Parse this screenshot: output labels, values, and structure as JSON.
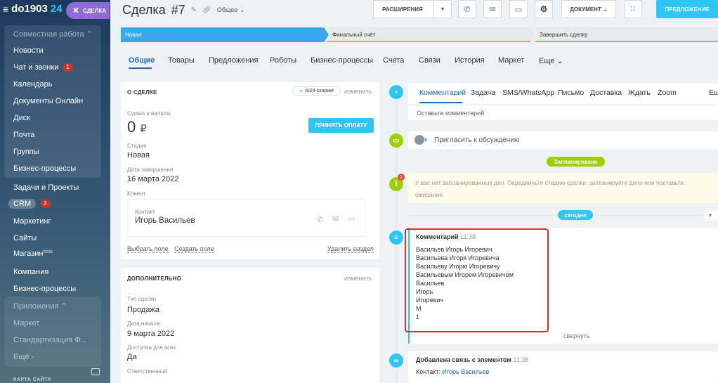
{
  "sidebar": {
    "portal_name": "do1903",
    "portal_suffix": "24",
    "close_label": "СДЕЛКА",
    "group_title": "Совместная работа",
    "items": [
      {
        "label": "Новости"
      },
      {
        "label": "Чат и звонки",
        "badge": "1"
      },
      {
        "label": "Календарь"
      },
      {
        "label": "Документы Онлайн"
      },
      {
        "label": "Диск"
      },
      {
        "label": "Почта"
      },
      {
        "label": "Группы"
      },
      {
        "label": "Бизнес-процессы"
      },
      {
        "label": "Задачи и Проекты"
      },
      {
        "label": "CRM",
        "badge": "2"
      },
      {
        "label": "Маркетинг"
      },
      {
        "label": "Сайты"
      },
      {
        "label": "Магазин",
        "sup": "beta"
      },
      {
        "label": "Компания"
      },
      {
        "label": "Бизнес-процессы"
      }
    ],
    "group2_title": "Приложения",
    "group2_items": [
      {
        "label": "Маркет"
      },
      {
        "label": "Стандартизация Ф..."
      },
      {
        "label": "Ещё -"
      }
    ],
    "footer_label": "КАРТА САЙТА"
  },
  "header": {
    "title": "Сделка",
    "number": "#7",
    "category": "Общее",
    "extensions_label": "РАСШИРЕНИЯ",
    "document_label": "ДОКУМЕНТ",
    "proposal_label": "ПРЕДЛОЖЕНИЕ"
  },
  "stages": [
    {
      "label": "Новая",
      "color": "#39a8ef"
    },
    {
      "label": "Финальный счёт",
      "color": "#e9eaeb"
    },
    {
      "label": "Завершить сделку",
      "color": "#e9eaeb"
    }
  ],
  "tabs": [
    "Общие",
    "Товары",
    "Предложения",
    "Роботы",
    "Бизнес-процессы",
    "Счета",
    "Связи",
    "История",
    "Маркет",
    "Еще"
  ],
  "about": {
    "header": "О СДЕЛКЕ",
    "ai_label": "AI24-скоринг",
    "change_label": "изменить",
    "amount_label": "Сумма и валюта",
    "amount_value": "0",
    "currency": "₽",
    "pay_button": "ПРИНЯТЬ ОПЛАТУ",
    "stage_label": "Стадия",
    "stage_value": "Новая",
    "close_date_label": "Дата завершения",
    "close_date_value": "16 марта 2022",
    "client_label": "Клиент",
    "contact_label": "Контакт",
    "contact_name": "Игорь Васильев",
    "select_field": "Выбрать поле",
    "create_field": "Создать поле",
    "delete_section": "Удалить раздел"
  },
  "additional": {
    "header": "ДОПОЛНИТЕЛЬНО",
    "change_label": "изменить",
    "deal_type_label": "Тип сделки",
    "deal_type_value": "Продажа",
    "start_date_label": "Дата начала",
    "start_date_value": "9 марта 2022",
    "available_label": "Доступна для всех",
    "available_value": "Да",
    "responsible_label": "Ответственный"
  },
  "timeline": {
    "composer_tabs": [
      "Комментарий",
      "Задача",
      "SMS/WhatsApp",
      "Письмо",
      "Доставка",
      "Ждать",
      "Zoom",
      "Ещ"
    ],
    "comment_placeholder": "Оставьте комментарий",
    "invite_label": "Пригласить к обсуждению",
    "planned_label": "Запланировано",
    "planned_badge": "1",
    "no_plans_text_1": "У вас нет запланированных дел. Передвиньте стадию сделки, запланируйте дело или поставьте",
    "no_plans_text_2": "ожидание.",
    "today_label": "сегодня",
    "comment_title": "Комментарий",
    "comment_time": "11:38",
    "comment_lines": [
      "Васильев Игорь Игоревич",
      "Васильева Игоря Игоревича",
      "Васильеву Игорю Игоревичу",
      "Васильевым Игорем Игоревичем",
      "Васильев",
      "Игорь",
      "Игоревич",
      "М",
      "1"
    ],
    "collapse_label": "свернуть",
    "link_title": "Добавлена связь с элементом",
    "link_time": "11:38",
    "link_contact_label": "Контакт:",
    "link_contact_name": "Игорь Васильев"
  },
  "colors": {
    "accent": "#2fc6f6",
    "link": "#2067b0",
    "green": "#9dcf00",
    "highlight": "#d9302a"
  }
}
